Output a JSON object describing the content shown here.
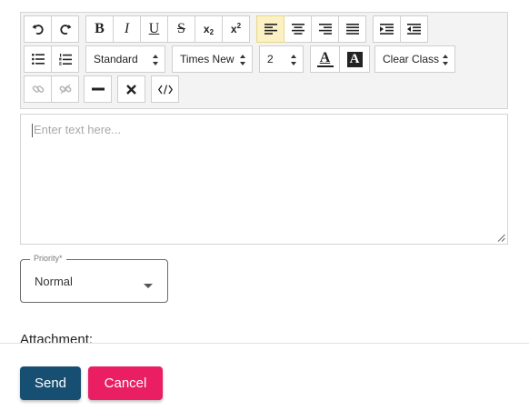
{
  "toolbar": {
    "row1": [
      {
        "name": "undo-icon"
      },
      {
        "name": "redo-icon"
      },
      {
        "name": "bold-button",
        "text": "B"
      },
      {
        "name": "italic-button",
        "text": "I"
      },
      {
        "name": "underline-button",
        "text": "U"
      },
      {
        "name": "strikethrough-button",
        "text": "S"
      },
      {
        "name": "subscript-button"
      },
      {
        "name": "superscript-button"
      },
      {
        "name": "align-left-icon",
        "active": true
      },
      {
        "name": "align-center-icon"
      },
      {
        "name": "align-right-icon"
      },
      {
        "name": "align-justify-icon"
      },
      {
        "name": "indent-icon"
      },
      {
        "name": "outdent-icon"
      }
    ],
    "format_select": "Standard",
    "font_select": "Times New Roman",
    "size_select": "2",
    "font_color_label": "A",
    "highlight_label": "A",
    "class_select": "Clear Class",
    "sub_label": "x",
    "sub_small": "2",
    "sup_label": "x",
    "sup_small": "2"
  },
  "editor": {
    "placeholder": "Enter text here..."
  },
  "priority": {
    "label": "Priority*",
    "value": "Normal"
  },
  "attachment_label": "Attachment:",
  "buttons": {
    "send": "Send",
    "cancel": "Cancel"
  },
  "colors": {
    "send": "#174f73",
    "cancel": "#e91e63",
    "active_button": "#fbf1c4"
  }
}
